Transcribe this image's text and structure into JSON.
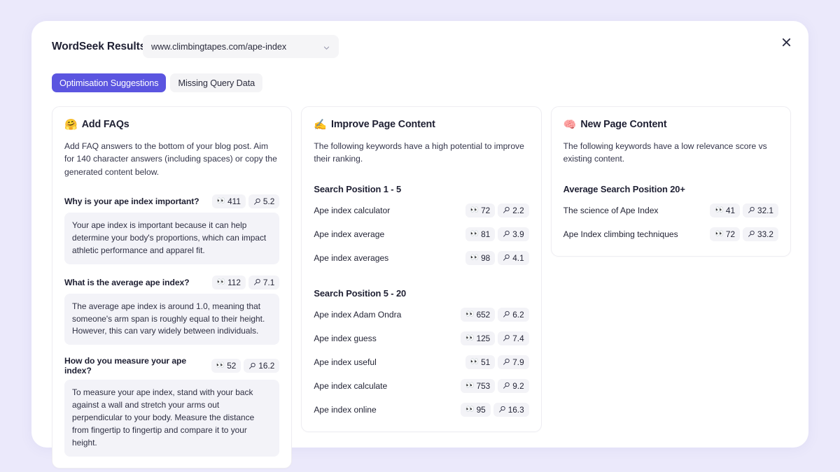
{
  "header": {
    "title": "WordSeek Results",
    "url_value": "www.climbingtapes.com/ape-index",
    "chevron_icon": "chevron-down-icon",
    "close_icon": "close-icon"
  },
  "tabs": [
    {
      "label": "Optimisation Suggestions",
      "active": true
    },
    {
      "label": "Missing Query Data",
      "active": false
    }
  ],
  "colors": {
    "page_background": "#ebe9fb",
    "modal_background": "#ffffff",
    "accent": "#5b55e0",
    "tab_inactive_bg": "#f4f4f6",
    "badge_bg": "#f3f3f7",
    "faq_answer_bg": "#f3f3f8",
    "card_border": "#eeedf2",
    "text_primary": "#1f2033"
  },
  "icons": {
    "impressions": "eyes-icon",
    "position": "magnifying-glass-icon"
  },
  "cards": {
    "faqs": {
      "emoji": "🤗",
      "emoji_name": "hugging-face-emoji",
      "title": "Add FAQs",
      "description": "Add FAQ answers to the bottom of your blog post. Aim for 140 character answers (including spaces) or copy the generated content below.",
      "items": [
        {
          "question": "Why is your ape index important?",
          "impressions": "411",
          "position": "5.2",
          "answer": "Your ape index is important because it can help determine your body's proportions, which can impact athletic performance and apparel fit."
        },
        {
          "question": "What is the average ape index?",
          "impressions": "112",
          "position": "7.1",
          "answer": "The average ape index is around 1.0, meaning that someone's arm span is roughly equal to their height. However, this can vary widely between individuals."
        },
        {
          "question": "How do you measure your ape index?",
          "impressions": "52",
          "position": "16.2",
          "answer": "To measure your ape index, stand with your back against a wall and stretch your arms out perpendicular to your body. Measure the distance from fingertip to fingertip and compare it to your height."
        }
      ]
    },
    "improve": {
      "emoji": "✍️",
      "emoji_name": "writing-hand-emoji",
      "title": "Improve Page Content",
      "description": "The following keywords have a high potential to improve their ranking.",
      "sections": [
        {
          "heading": "Search Position 1 - 5",
          "rows": [
            {
              "keyword": "Ape index calculator",
              "impressions": "72",
              "position": "2.2"
            },
            {
              "keyword": "Ape index average",
              "impressions": "81",
              "position": "3.9"
            },
            {
              "keyword": "Ape index averages",
              "impressions": "98",
              "position": "4.1"
            }
          ]
        },
        {
          "heading": "Search Position 5 - 20",
          "rows": [
            {
              "keyword": "Ape index Adam Ondra",
              "impressions": "652",
              "position": "6.2"
            },
            {
              "keyword": "Ape index guess",
              "impressions": "125",
              "position": "7.4"
            },
            {
              "keyword": "Ape index useful",
              "impressions": "51",
              "position": "7.9"
            },
            {
              "keyword": "Ape index calculate",
              "impressions": "753",
              "position": "9.2"
            },
            {
              "keyword": "Ape index online",
              "impressions": "95",
              "position": "16.3"
            }
          ]
        }
      ]
    },
    "newpage": {
      "emoji": "🧠",
      "emoji_name": "brain-emoji",
      "title": "New Page Content",
      "description": "The following keywords have a low relevance score vs existing content.",
      "sections": [
        {
          "heading": "Average Search Position 20+",
          "rows": [
            {
              "keyword": "The science of Ape Index",
              "impressions": "41",
              "position": "32.1"
            },
            {
              "keyword": "Ape Index climbing techniques",
              "impressions": "72",
              "position": "33.2"
            }
          ]
        }
      ]
    }
  }
}
